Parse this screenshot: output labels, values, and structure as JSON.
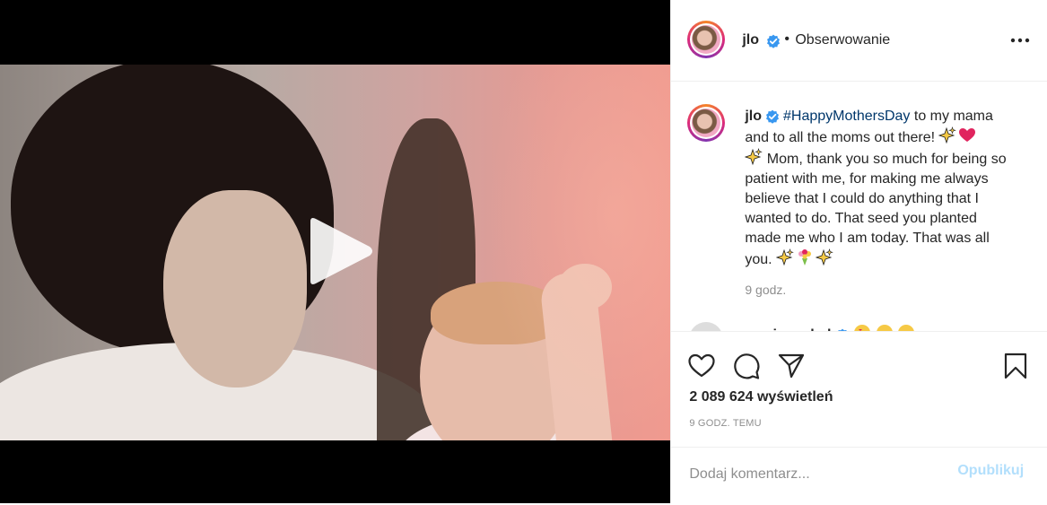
{
  "post": {
    "media": {
      "play_icon": "play-icon",
      "photo": "mother-holding-baby-photo"
    },
    "author": {
      "username": "jlo",
      "verified_icon": "verified-badge-icon",
      "separator": "•",
      "follow_status": "Obserwowanie"
    },
    "more_icon": "more-options-icon",
    "caption": {
      "username": "jlo",
      "hashtag": "#HappyMothersDay",
      "line1_rest": " to my mama and to all the moms out there! ",
      "line2": " Mom, thank you so much for being so patient with me, for making me always believe that I could do anything that I wanted to do. That seed you planted made me who I am today. That was all you. ",
      "emojis": [
        "sparkles-icon",
        "red-heart-icon",
        "sparkles-icon",
        "sparkles-icon",
        "bouquet-icon",
        "sparkles-icon"
      ],
      "time": "9 godz."
    },
    "next_comment": {
      "username": "parrisgoebel",
      "emojis": [
        "verified-badge-icon",
        "heart-eyes-icon",
        "heart-eyes-icon",
        "heart-eyes-icon"
      ]
    },
    "actions": {
      "like_icon": "heart-icon",
      "comment_icon": "comment-bubble-icon",
      "share_icon": "paper-plane-icon",
      "save_icon": "bookmark-icon"
    },
    "views": "2 089 624 wyświetleń",
    "time_ago": "9 godz. temu",
    "comment_box": {
      "placeholder": "Dodaj komentarz...",
      "publish_label": "Opublikuj"
    }
  },
  "colors": {
    "text": "#262626",
    "muted": "#8e8e8e",
    "hashtag": "#00376b",
    "verified": "#3897f0",
    "publish_disabled": "#b2dffc",
    "border": "#efefef"
  }
}
